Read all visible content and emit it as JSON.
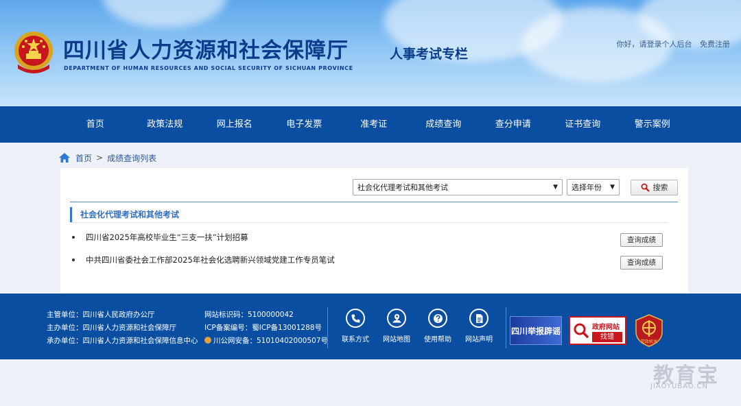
{
  "header": {
    "title": "四川省人力资源和社会保障厅",
    "subtitle": "DEPARTMENT OF HUMAN RESOURCES AND SOCIAL SECURITY OF SICHUAN PROVINCE",
    "section_tag": "人事考试专栏",
    "login_text": "你好，请登录个人后台",
    "register_text": "免费注册"
  },
  "nav": {
    "items": [
      "首页",
      "政策法规",
      "网上报名",
      "电子发票",
      "准考证",
      "成绩查询",
      "查分申请",
      "证书查询",
      "警示案例"
    ]
  },
  "breadcrumb": {
    "home": "首页",
    "separator": ">",
    "current": "成绩查询列表"
  },
  "filters": {
    "exam_type": "社会化代理考试和其他考试",
    "year": "选择年份",
    "search_label": "搜索"
  },
  "category": {
    "title": "社会化代理考试和其他考试"
  },
  "results": [
    {
      "title": "四川省2025年高校毕业生“三支一扶”计划招募",
      "button": "查询成绩"
    },
    {
      "title": "中共四川省委社会工作部2025年社会化选聘新兴领域党建工作专员笔试",
      "button": "查询成绩"
    }
  ],
  "footer": {
    "info_left": [
      "主管单位：四川省人民政府办公厅",
      "主办单位：四川省人力资源和社会保障厅",
      "承办单位：四川省人力资源和社会保障信息中心"
    ],
    "info_right": [
      "网站标识码：5100000042",
      "ICP备案编号：蜀ICP备13001288号",
      "川公网安备：51010402000507号"
    ],
    "tools": [
      {
        "label": "联系方式",
        "icon": "phone-icon"
      },
      {
        "label": "网站地图",
        "icon": "map-icon"
      },
      {
        "label": "使用帮助",
        "icon": "help-icon"
      },
      {
        "label": "网站声明",
        "icon": "document-icon"
      }
    ],
    "report_logo": "四川举报辟谣",
    "error_logo_top": "政府网站",
    "error_logo_bottom": "找错",
    "party_logo_text": "党政机关"
  },
  "watermark": {
    "main": "教育宝",
    "sub": "JIAOYUBAO.CN"
  },
  "colors": {
    "nav_bg": "#0a4ea1",
    "accent": "#2f79d0",
    "title_blue": "#0b3c8c",
    "error_red": "#c7161e"
  }
}
